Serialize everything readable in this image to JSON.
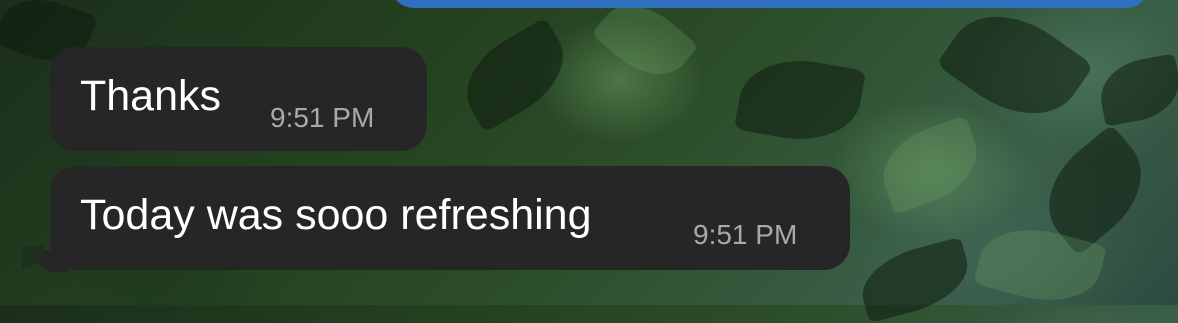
{
  "messages": [
    {
      "text": "Thanks",
      "time": "9:51 PM"
    },
    {
      "text": "Today was sooo refreshing",
      "time": "9:51 PM"
    }
  ],
  "colors": {
    "incoming_bubble": "#262626",
    "outgoing_bubble": "#2f6fc0",
    "timestamp": "#a9a9a9",
    "text": "#ffffff"
  }
}
